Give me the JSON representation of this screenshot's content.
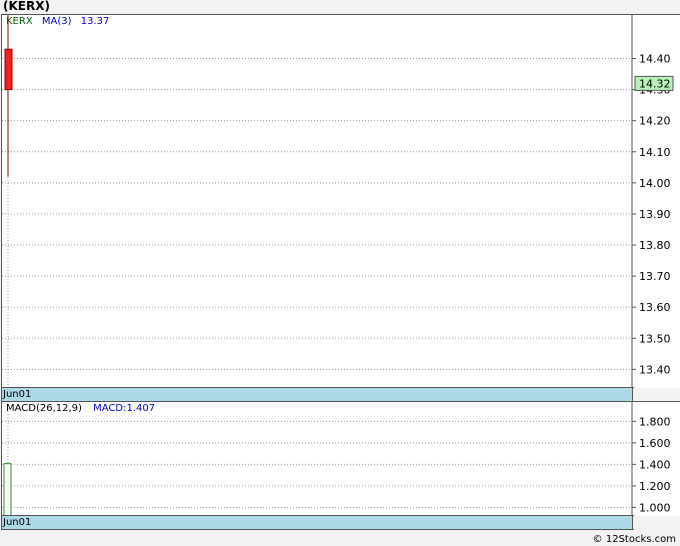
{
  "title": "(KERX)",
  "watermark": "© 12Stocks.com",
  "price_panel": {
    "legend_symbol": "KERX",
    "legend_ma_label": "MA(3)",
    "legend_ma_value": "13.37",
    "current_price_label": "14.32",
    "date_label": "Jun01"
  },
  "macd_panel": {
    "legend_label": "MACD(26,12,9)",
    "legend_value": "MACD:1.407",
    "date_label": "Jun01"
  },
  "colors": {
    "candle_down": "#ee2222",
    "candle_outline": "#8b0000",
    "price_tag_bg": "#b8f0b8",
    "macd_bar": "#2e8b2e",
    "date_bar": "#add8e6",
    "symbol_color": "#006400",
    "ma_color": "#0000cc"
  },
  "chart_data": [
    {
      "type": "candlestick",
      "x": [
        "Jun01"
      ],
      "ylim": [
        13.34,
        14.54
      ],
      "yticks": [
        "14.40",
        "14.30",
        "14.20",
        "14.10",
        "14.00",
        "13.90",
        "13.80",
        "13.70",
        "13.60",
        "13.50",
        "13.40"
      ],
      "series": [
        {
          "name": "KERX",
          "open": [
            14.43
          ],
          "close": [
            14.3
          ],
          "high": [
            14.54
          ],
          "low": [
            14.02
          ]
        }
      ],
      "ma": {
        "name": "MA(3)",
        "value": 13.37
      },
      "last_price": 14.32,
      "grid": true
    },
    {
      "type": "bar",
      "categories": [
        "Jun01"
      ],
      "ylim": [
        0.92,
        1.98
      ],
      "yticks": [
        "1.800",
        "1.600",
        "1.400",
        "1.200",
        "1.000"
      ],
      "series": [
        {
          "name": "MACD",
          "values": [
            1.407
          ]
        }
      ],
      "grid": true
    }
  ]
}
